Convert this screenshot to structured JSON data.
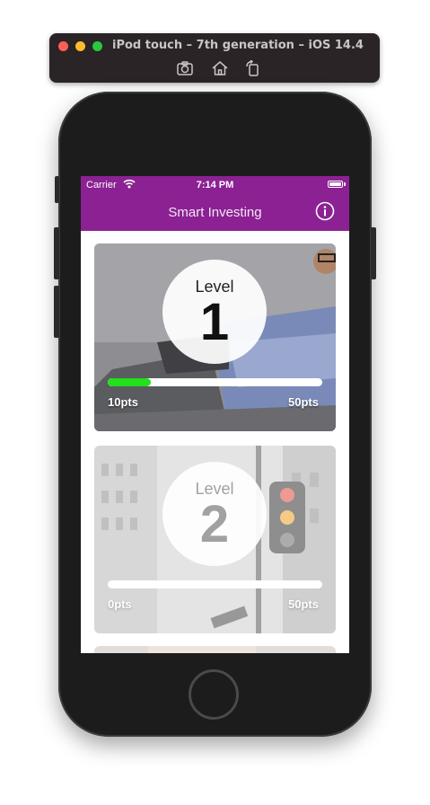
{
  "simulator": {
    "title": "iPod touch – 7th generation – iOS 14.4",
    "tools": [
      "screenshot-icon",
      "home-icon",
      "rotate-icon"
    ]
  },
  "status_bar": {
    "carrier": "Carrier",
    "time": "7:14 PM"
  },
  "nav": {
    "title": "Smart Investing",
    "info_icon": "info-circle-icon"
  },
  "colors": {
    "brand": "#8b2193",
    "progress": "#22e01a"
  },
  "levels": [
    {
      "word": "Level",
      "number": "1",
      "points": "10pts",
      "max_points": "50pts",
      "progress": 0.2
    },
    {
      "word": "Level",
      "number": "2",
      "points": "0pts",
      "max_points": "50pts",
      "progress": 0
    }
  ]
}
